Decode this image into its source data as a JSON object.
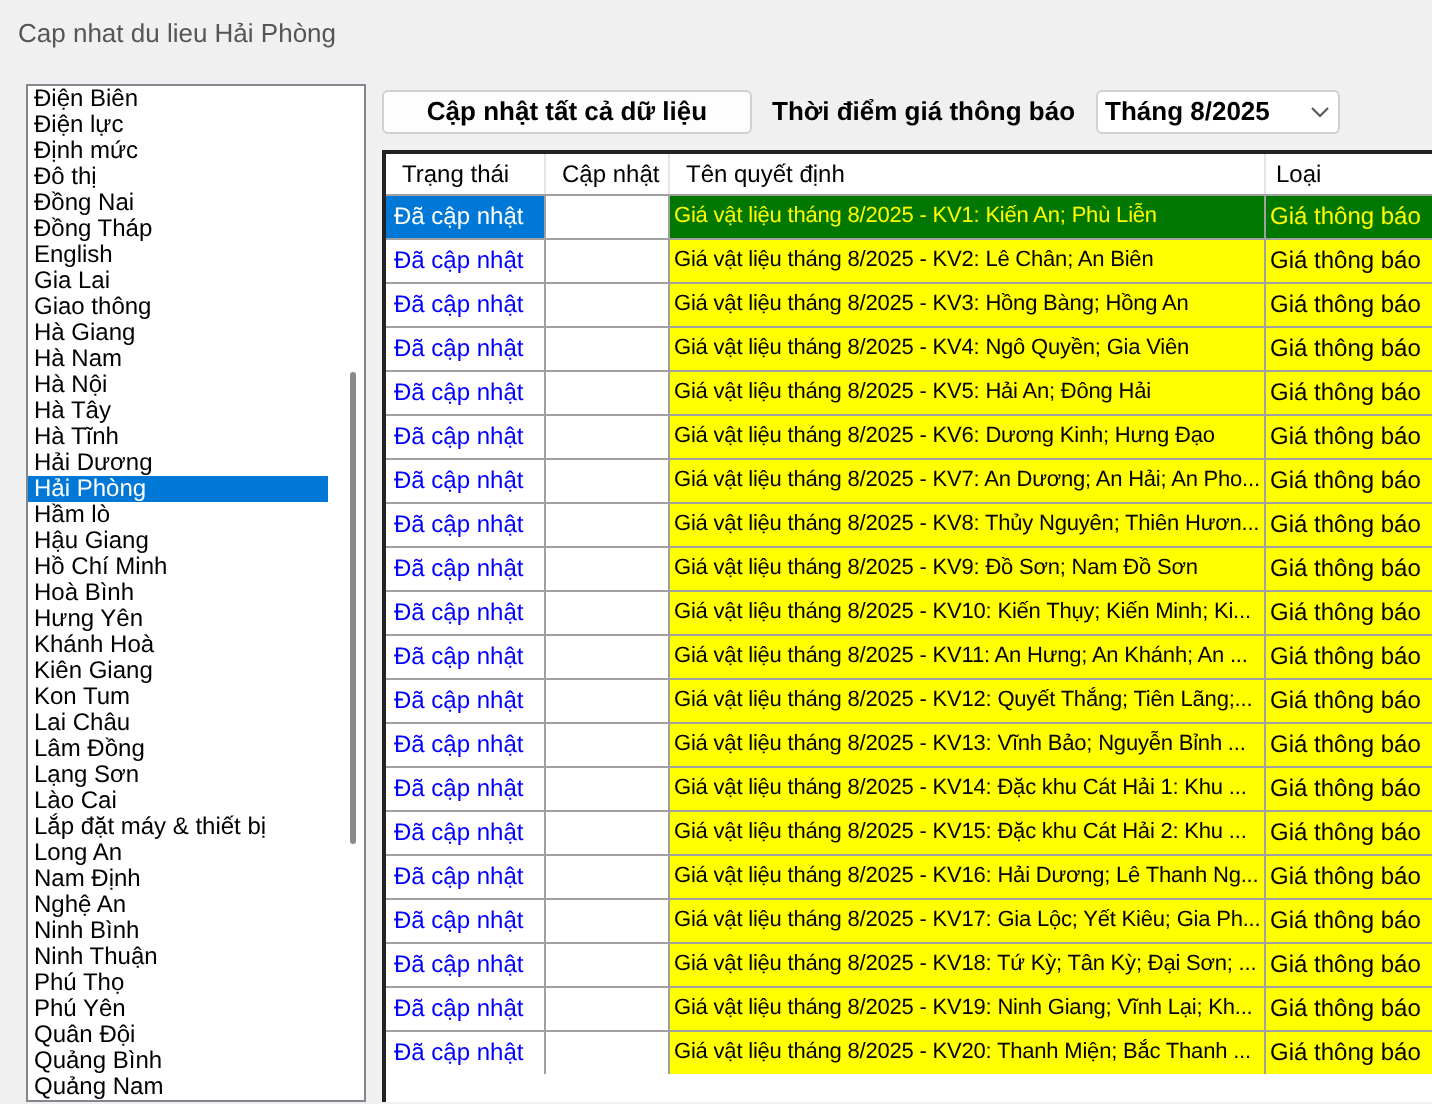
{
  "window": {
    "title": "Cap nhat du lieu Hải Phòng"
  },
  "provinces": [
    {
      "label": "Điện Biên",
      "selected": false
    },
    {
      "label": "Điện lực",
      "selected": false
    },
    {
      "label": "Định mức",
      "selected": false
    },
    {
      "label": "Đô thị",
      "selected": false
    },
    {
      "label": "Đồng Nai",
      "selected": false
    },
    {
      "label": "Đồng Tháp",
      "selected": false
    },
    {
      "label": "English",
      "selected": false
    },
    {
      "label": "Gia Lai",
      "selected": false
    },
    {
      "label": "Giao thông",
      "selected": false
    },
    {
      "label": "Hà Giang",
      "selected": false
    },
    {
      "label": "Hà Nam",
      "selected": false
    },
    {
      "label": "Hà Nội",
      "selected": false
    },
    {
      "label": "Hà Tây",
      "selected": false
    },
    {
      "label": "Hà Tĩnh",
      "selected": false
    },
    {
      "label": "Hải Dương",
      "selected": false
    },
    {
      "label": "Hải Phòng",
      "selected": true
    },
    {
      "label": "Hầm lò",
      "selected": false
    },
    {
      "label": "Hậu Giang",
      "selected": false
    },
    {
      "label": "Hồ Chí Minh",
      "selected": false
    },
    {
      "label": "Hoà Bình",
      "selected": false
    },
    {
      "label": "Hưng Yên",
      "selected": false
    },
    {
      "label": "Khánh Hoà",
      "selected": false
    },
    {
      "label": "Kiên Giang",
      "selected": false
    },
    {
      "label": "Kon Tum",
      "selected": false
    },
    {
      "label": "Lai Châu",
      "selected": false
    },
    {
      "label": "Lâm Đồng",
      "selected": false
    },
    {
      "label": "Lạng Sơn",
      "selected": false
    },
    {
      "label": "Lào Cai",
      "selected": false
    },
    {
      "label": "Lắp đặt máy & thiết bị",
      "selected": false
    },
    {
      "label": "Long An",
      "selected": false
    },
    {
      "label": "Nam Định",
      "selected": false
    },
    {
      "label": "Nghệ An",
      "selected": false
    },
    {
      "label": "Ninh Bình",
      "selected": false
    },
    {
      "label": "Ninh Thuận",
      "selected": false
    },
    {
      "label": "Phú Thọ",
      "selected": false
    },
    {
      "label": "Phú Yên",
      "selected": false
    },
    {
      "label": "Quân Đội",
      "selected": false
    },
    {
      "label": "Quảng Bình",
      "selected": false
    },
    {
      "label": "Quảng Nam",
      "selected": false
    }
  ],
  "toolbar": {
    "update_all_button": "Cập nhật tất cả dữ liệu",
    "period_label": "Thời điểm giá thông báo",
    "period_value": "Tháng 8/2025"
  },
  "table": {
    "columns": [
      "Trạng thái",
      "Cập nhật",
      "Tên quyết định",
      "Loại"
    ],
    "rows": [
      {
        "status": "Đã cập nhật",
        "name": "Giá vật liệu tháng 8/2025 - KV1: Kiến An; Phù Liễn",
        "type": "Giá thông báo",
        "selected": true
      },
      {
        "status": "Đã cập nhật",
        "name": "Giá vật liệu tháng 8/2025 - KV2: Lê Chân; An Biên",
        "type": "Giá thông báo",
        "selected": false
      },
      {
        "status": "Đã cập nhật",
        "name": "Giá vật liệu tháng 8/2025 - KV3: Hồng Bàng; Hồng An",
        "type": "Giá thông báo",
        "selected": false
      },
      {
        "status": "Đã cập nhật",
        "name": "Giá vật liệu tháng 8/2025 - KV4: Ngô Quyền; Gia Viên",
        "type": "Giá thông báo",
        "selected": false
      },
      {
        "status": "Đã cập nhật",
        "name": "Giá vật liệu tháng 8/2025 - KV5: Hải An; Đông Hải",
        "type": "Giá thông báo",
        "selected": false
      },
      {
        "status": "Đã cập nhật",
        "name": "Giá vật liệu tháng 8/2025 - KV6: Dương Kinh; Hưng Đạo",
        "type": "Giá thông báo",
        "selected": false
      },
      {
        "status": "Đã cập nhật",
        "name": "Giá vật liệu tháng 8/2025 - KV7: An Dương; An Hải; An Pho...",
        "type": "Giá thông báo",
        "selected": false
      },
      {
        "status": "Đã cập nhật",
        "name": "Giá vật liệu tháng 8/2025 - KV8: Thủy Nguyên; Thiên Hươn...",
        "type": "Giá thông báo",
        "selected": false
      },
      {
        "status": "Đã cập nhật",
        "name": "Giá vật liệu tháng 8/2025 - KV9: Đồ Sơn; Nam Đồ Sơn",
        "type": "Giá thông báo",
        "selected": false
      },
      {
        "status": "Đã cập nhật",
        "name": "Giá vật liệu tháng 8/2025 - KV10: Kiến Thụy; Kiến Minh; Ki...",
        "type": "Giá thông báo",
        "selected": false
      },
      {
        "status": "Đã cập nhật",
        "name": "Giá vật liệu tháng 8/2025 - KV11: An Hưng; An Khánh; An ...",
        "type": "Giá thông báo",
        "selected": false
      },
      {
        "status": "Đã cập nhật",
        "name": "Giá vật liệu tháng 8/2025 - KV12: Quyết Thắng; Tiên Lãng;...",
        "type": "Giá thông báo",
        "selected": false
      },
      {
        "status": "Đã cập nhật",
        "name": "Giá vật liệu tháng 8/2025 - KV13: Vĩnh Bảo; Nguyễn Bỉnh ...",
        "type": "Giá thông báo",
        "selected": false
      },
      {
        "status": "Đã cập nhật",
        "name": "Giá vật liệu tháng 8/2025 - KV14: Đặc khu Cát Hải 1: Khu ...",
        "type": "Giá thông báo",
        "selected": false
      },
      {
        "status": "Đã cập nhật",
        "name": "Giá vật liệu tháng 8/2025 - KV15: Đặc khu Cát Hải 2: Khu ...",
        "type": "Giá thông báo",
        "selected": false
      },
      {
        "status": "Đã cập nhật",
        "name": "Giá vật liệu tháng 8/2025 - KV16: Hải Dương; Lê Thanh Ng...",
        "type": "Giá thông báo",
        "selected": false
      },
      {
        "status": "Đã cập nhật",
        "name": "Giá vật liệu tháng 8/2025 - KV17: Gia Lộc; Yết Kiêu; Gia Ph...",
        "type": "Giá thông báo",
        "selected": false
      },
      {
        "status": "Đã cập nhật",
        "name": "Giá vật liệu tháng 8/2025 - KV18: Tứ Kỳ; Tân Kỳ; Đại Sơn; ...",
        "type": "Giá thông báo",
        "selected": false
      },
      {
        "status": "Đã cập nhật",
        "name": "Giá vật liệu tháng 8/2025 - KV19: Ninh Giang; Vĩnh Lại; Kh...",
        "type": "Giá thông báo",
        "selected": false
      },
      {
        "status": "Đã cập nhật",
        "name": "Giá vật liệu tháng 8/2025 - KV20: Thanh Miện; Bắc Thanh ...",
        "type": "Giá thông báo",
        "selected": false
      }
    ]
  }
}
